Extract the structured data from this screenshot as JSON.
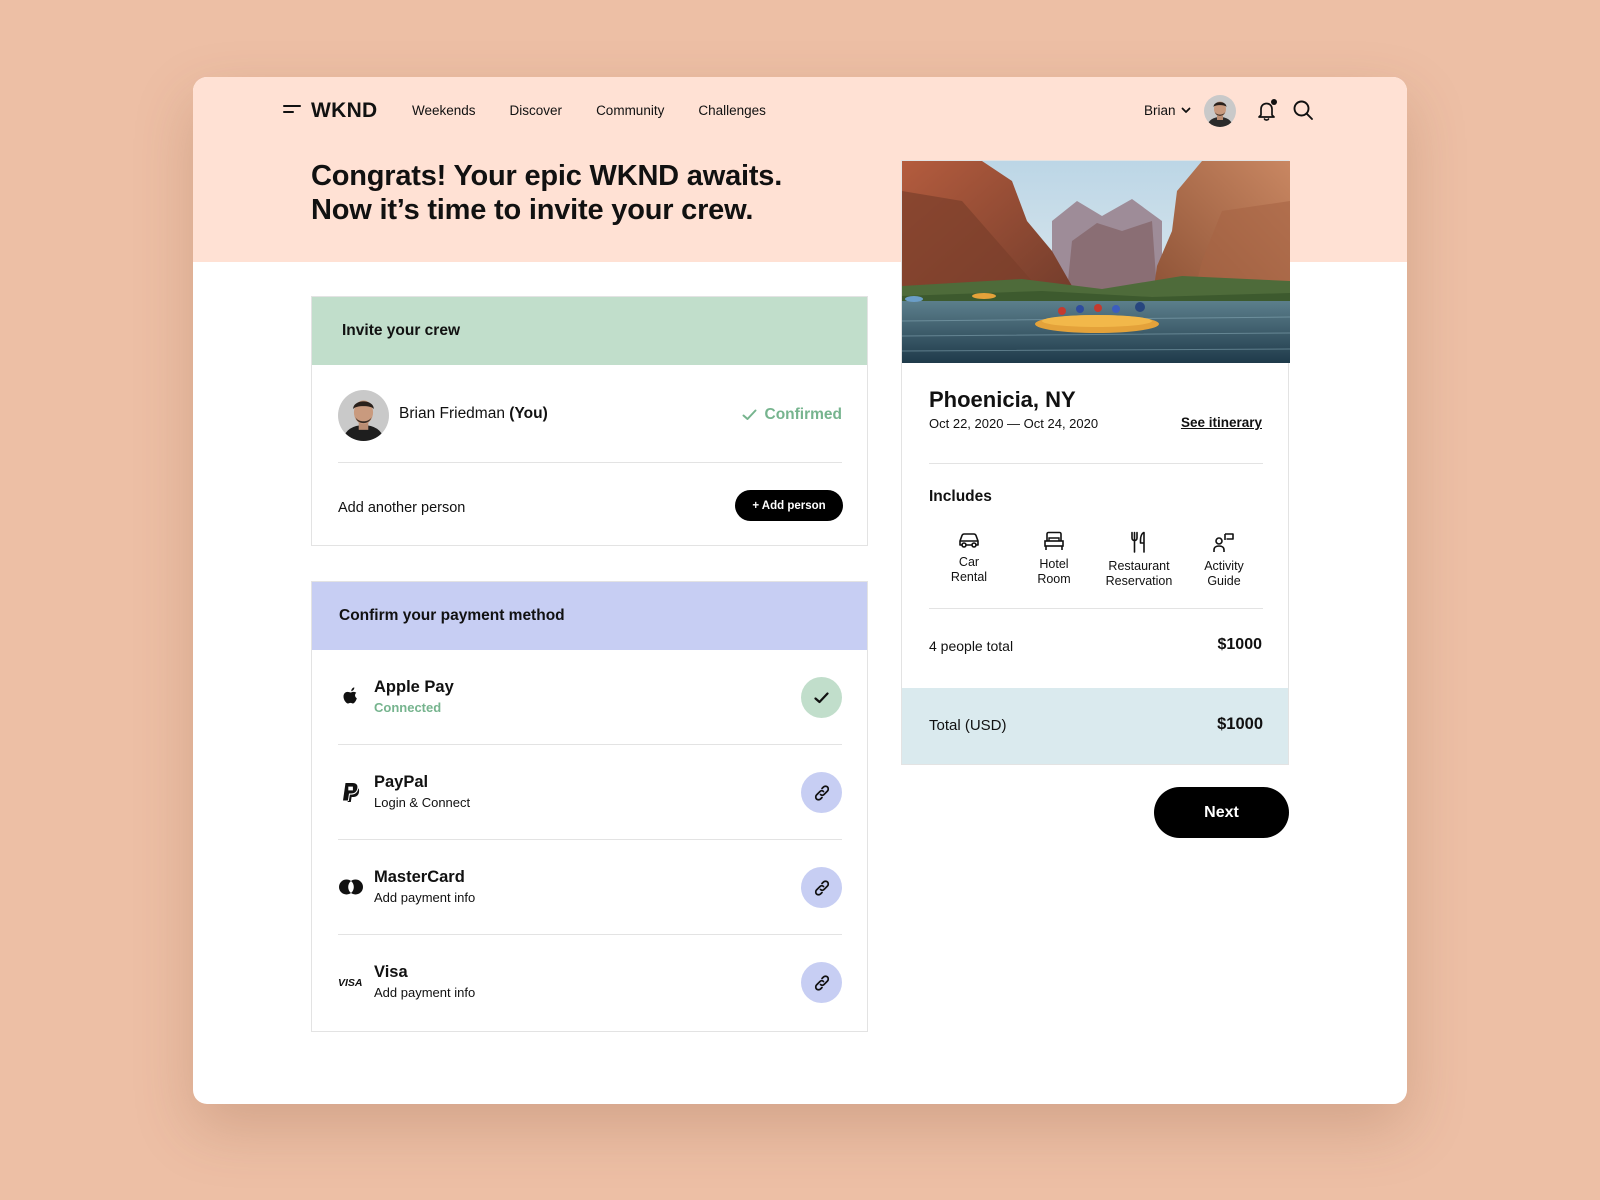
{
  "nav": {
    "logo": "WKND",
    "links": [
      "Weekends",
      "Discover",
      "Community",
      "Challenges"
    ],
    "user_name": "Brian"
  },
  "hero": {
    "line1": "Congrats! Your epic WKND awaits.",
    "line2": "Now it’s time to invite your crew."
  },
  "invite": {
    "title": "Invite your crew",
    "person_name": "Brian Friedman",
    "person_tag": "(You)",
    "status": "Confirmed",
    "add_label": "Add another person",
    "add_button": "+ Add person"
  },
  "payment": {
    "title": "Confirm your payment method",
    "methods": [
      {
        "name": "Apple Pay",
        "status": "Connected",
        "icon": "apple-icon",
        "state": "connected"
      },
      {
        "name": "PayPal",
        "status": "Login & Connect",
        "icon": "paypal-icon",
        "state": "link"
      },
      {
        "name": "MasterCard",
        "status": "Add payment info",
        "icon": "mastercard-icon",
        "state": "link"
      },
      {
        "name": "Visa",
        "status": "Add payment info",
        "icon": "visa-icon",
        "state": "link"
      }
    ]
  },
  "trip": {
    "place": "Phoenicia, NY",
    "dates": "Oct 22, 2020 — Oct 24, 2020",
    "itinerary_link": "See itinerary",
    "includes_title": "Includes",
    "includes": [
      {
        "line1": "Car",
        "line2": "Rental",
        "icon": "car-icon"
      },
      {
        "line1": "Hotel",
        "line2": "Room",
        "icon": "bed-icon"
      },
      {
        "line1": "Restaurant",
        "line2": "Reservation",
        "icon": "utensils-icon"
      },
      {
        "line1": "Activity",
        "line2": "Guide",
        "icon": "guide-icon"
      }
    ],
    "people_label": "4 people total",
    "people_price": "$1000",
    "total_label": "Total (USD)",
    "total_price": "$1000",
    "next_button": "Next"
  },
  "colors": {
    "page_bg": "#EDBFA5",
    "hero_bg": "#FFE1D4",
    "invite_header": "#C1DECB",
    "payment_header": "#C7CEF3",
    "total_band": "#DAEAEE",
    "confirmed_green": "#76B48E"
  }
}
